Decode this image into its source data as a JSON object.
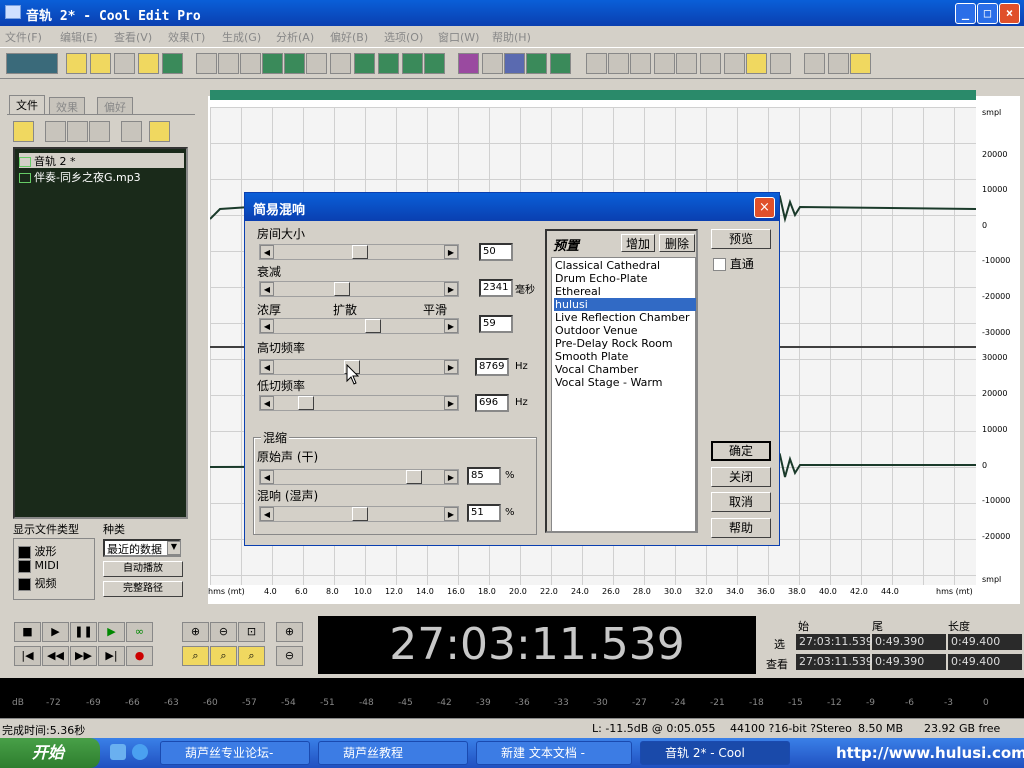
{
  "app": {
    "title": "音轨   2* - Cool Edit Pro"
  },
  "menu": [
    "文件(F)",
    "编辑(E)",
    "查看(V)",
    "效果(T)",
    "生成(G)",
    "分析(A)",
    "偏好(B)",
    "选项(O)",
    "窗口(W)",
    "帮助(H)"
  ],
  "left_tabs": [
    "文件",
    "效果",
    "偏好"
  ],
  "files": [
    {
      "name": "音轨   2 *",
      "selected": true
    },
    {
      "name": "伴奏-同乡之夜G.mp3",
      "selected": false
    }
  ],
  "filter": {
    "title": "显示文件类型",
    "kind_title": "种类",
    "items": [
      "波形",
      "MIDI",
      "视频"
    ],
    "kind_value": "最近的数据",
    "autoplay": "自动播放",
    "fullpath": "完整路径"
  },
  "scale_right": [
    "smpl",
    "20000",
    "10000",
    "0",
    "-10000",
    "-20000",
    "-30000",
    "30000",
    "20000",
    "10000",
    "0",
    "-10000",
    "-20000",
    "smpl"
  ],
  "ruler": [
    "hms (mt)",
    "4.0",
    "6.0",
    "8.0",
    "10.0",
    "12.0",
    "14.0",
    "16.0",
    "18.0",
    "20.0",
    "22.0",
    "24.0",
    "26.0",
    "28.0",
    "30.0",
    "32.0",
    "34.0",
    "36.0",
    "38.0",
    "40.0",
    "42.0",
    "44.0",
    "hms (mt)"
  ],
  "time_display": "27:03:11.539",
  "selection": {
    "col_start": "始",
    "col_end": "尾",
    "col_len": "长度",
    "row_sel": "选",
    "row_view": "查看",
    "sel_start": "27:03:11.539",
    "sel_end": "0:49.390",
    "sel_len": "0:49.400",
    "view_start": "27:03:11.539",
    "view_end": "0:49.390",
    "view_len": "0:49.400"
  },
  "level_ticks": [
    "dB",
    "-72",
    "-69",
    "-66",
    "-63",
    "-60",
    "-57",
    "-54",
    "-51",
    "-48",
    "-45",
    "-42",
    "-39",
    "-36",
    "-33",
    "-30",
    "-27",
    "-24",
    "-21",
    "-18",
    "-15",
    "-12",
    "-9",
    "-6",
    "-3",
    "0"
  ],
  "status": {
    "done": "完成时间:5.36秒",
    "level": "L: -11.5dB @  0:05.055",
    "format": "44100 ?16-bit ?Stereo",
    "size": "8.50 MB",
    "free": "23.92 GB free"
  },
  "taskbar": {
    "start": "开始",
    "tasks": [
      "葫芦丝专业论坛-",
      "葫芦丝教程",
      "新建 文本文档 -",
      "音轨   2* - Cool"
    ],
    "url": "http://www.hulusi.com"
  },
  "dialog": {
    "title": "简易混响",
    "room_size": {
      "label": "房间大小",
      "value": "50"
    },
    "decay": {
      "label": "衰减",
      "value": "2341",
      "unit": "毫秒"
    },
    "density": {
      "label": "浓厚",
      "mid": "扩散",
      "right": "平滑",
      "value": "59"
    },
    "high_cut": {
      "label": "高切频率",
      "value": "8769",
      "unit": "Hz"
    },
    "low_cut": {
      "label": "低切频率",
      "value": "696",
      "unit": "Hz"
    },
    "mix": {
      "title": "混缩",
      "dry_label": "原始声 (干)",
      "dry_value": "85",
      "wet_label": "混响 (湿声)",
      "wet_value": "51",
      "unit": "%"
    },
    "presets": {
      "title": "预置",
      "add": "增加",
      "delete": "删除",
      "items": [
        "Classical Cathedral",
        "Drum Echo-Plate",
        "Ethereal",
        "hulusi",
        "Live Reflection Chamber",
        "Outdoor Venue",
        "Pre-Delay Rock Room",
        "Smooth Plate",
        "Vocal Chamber",
        "Vocal Stage - Warm"
      ],
      "selected_index": 3
    },
    "buttons": {
      "preview": "预览",
      "bypass": "直通",
      "ok": "确定",
      "close": "关闭",
      "cancel": "取消",
      "help": "帮助"
    }
  }
}
